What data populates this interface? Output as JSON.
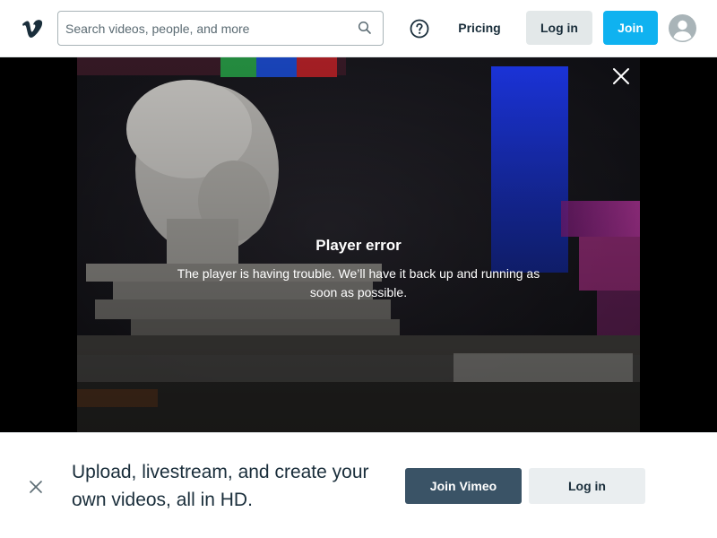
{
  "header": {
    "logo_alt": "Vimeo",
    "search_placeholder": "Search videos, people, and more",
    "pricing_label": "Pricing",
    "login_label": "Log in",
    "join_label": "Join",
    "join_color": "#0fb2f0"
  },
  "player": {
    "error_title": "Player error",
    "error_message": "The player is having trouble. We’ll have it back up and running as soon as possible."
  },
  "banner": {
    "headline": "Upload, livestream, and create your own videos, all in HD.",
    "join_label": "Join Vimeo",
    "login_label": "Log in",
    "join_color": "#3a5366"
  },
  "icons": [
    "vimeo-logo-icon",
    "search-icon",
    "help-icon",
    "avatar-icon",
    "close-icon"
  ]
}
